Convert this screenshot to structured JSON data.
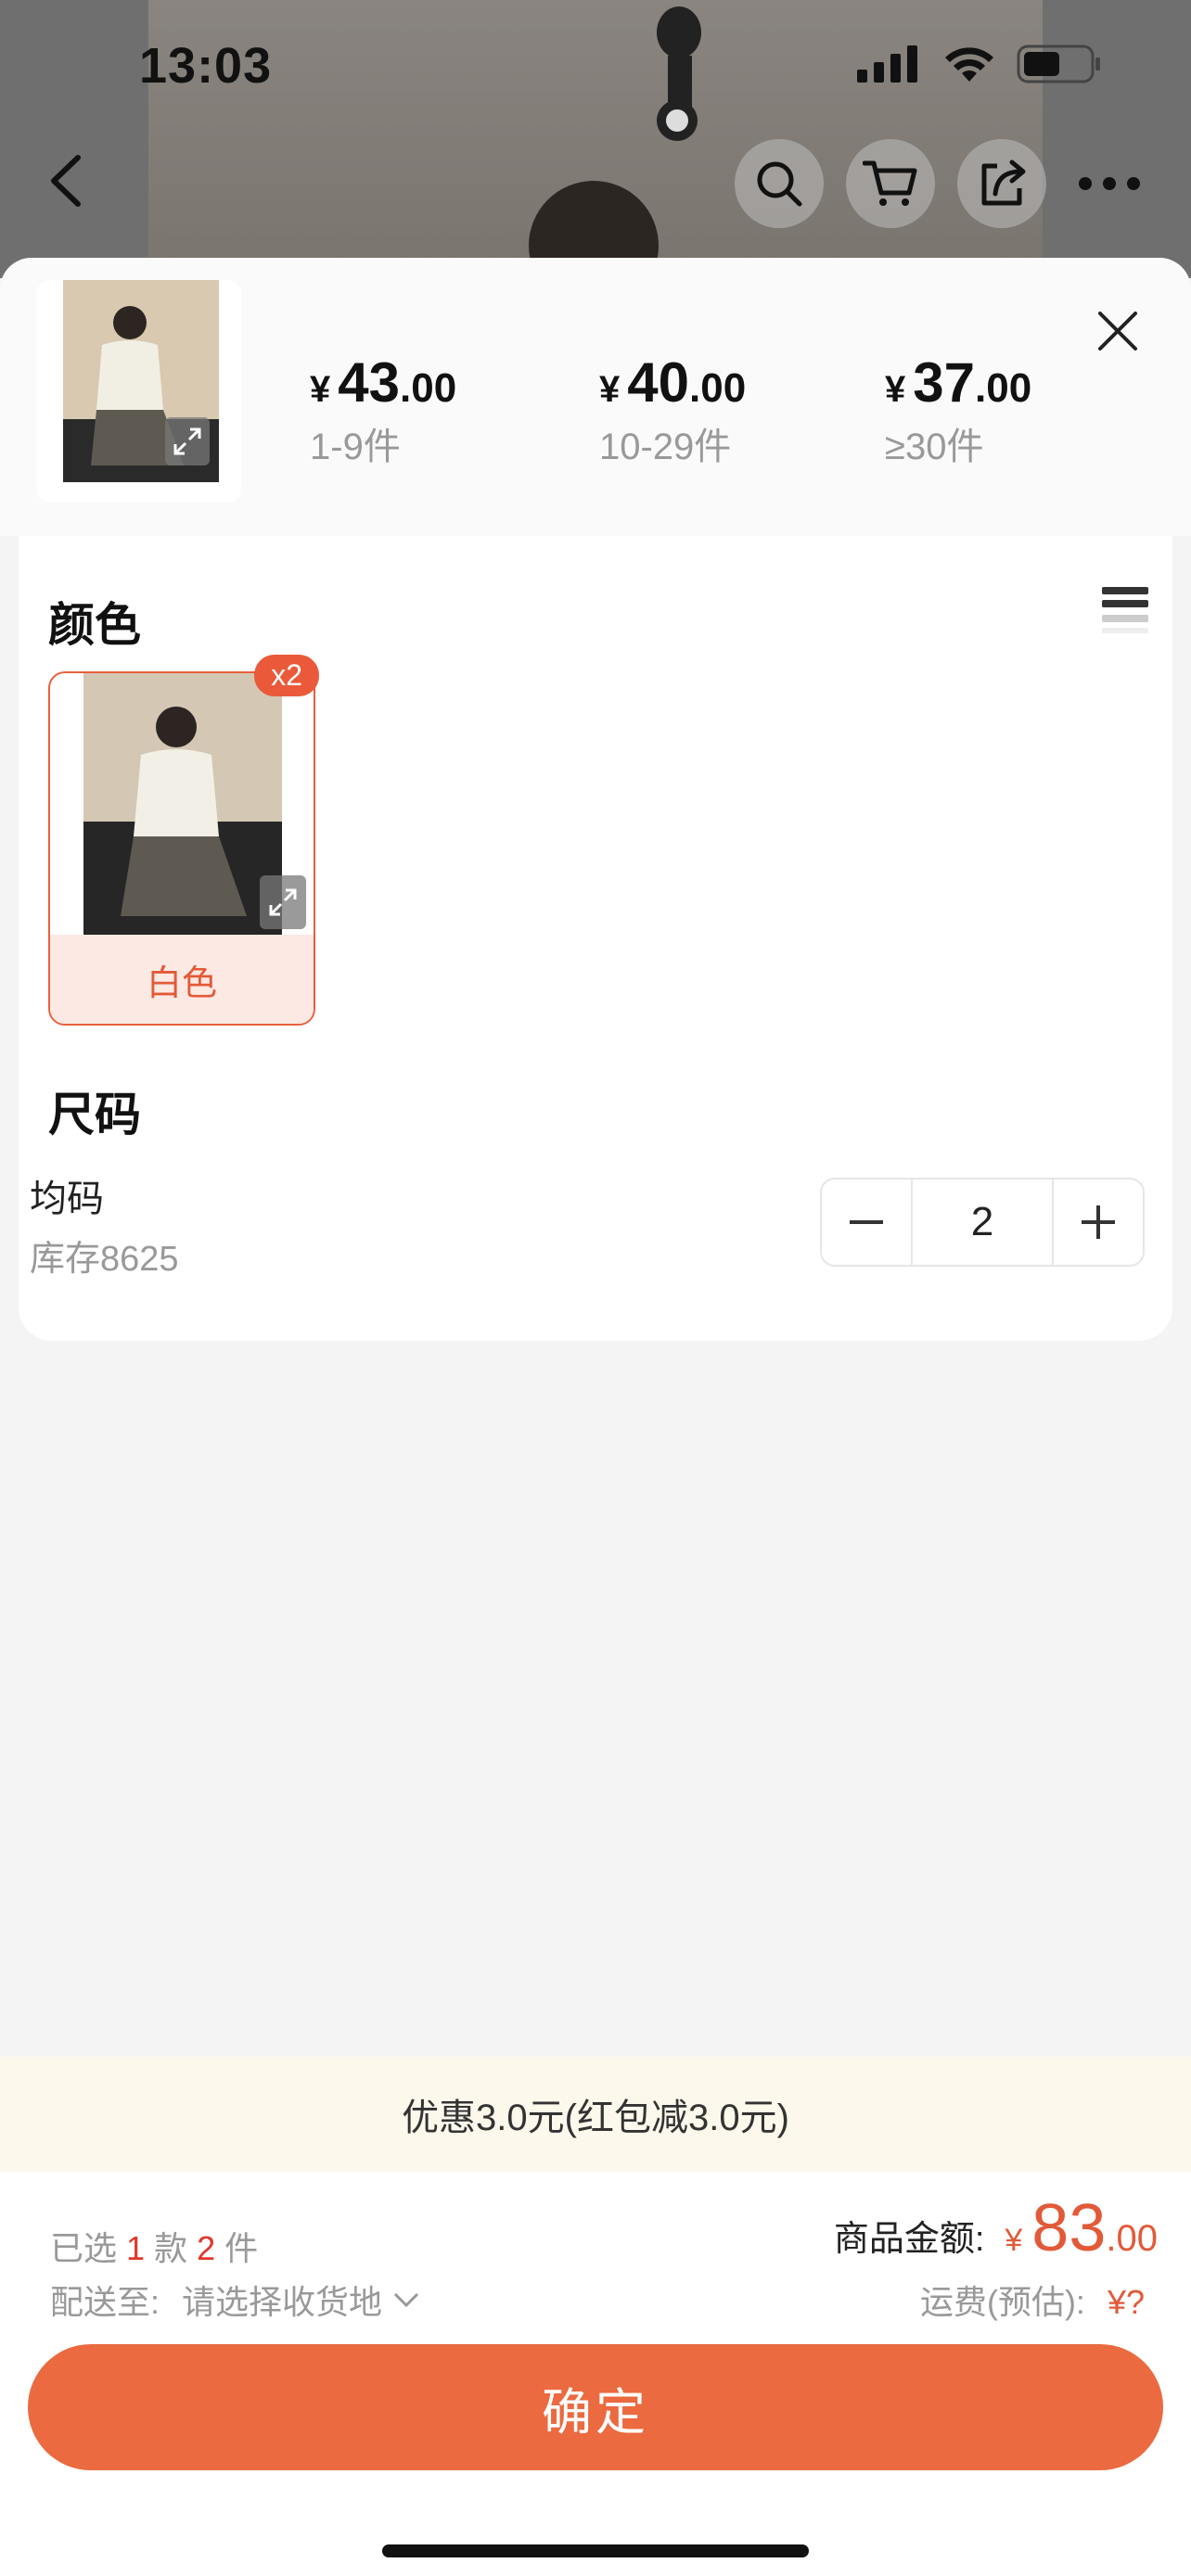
{
  "status": {
    "time": "13:03"
  },
  "nav": {
    "icons": [
      "back-icon",
      "search-icon",
      "cart-icon",
      "share-icon",
      "more-icon"
    ]
  },
  "prices": [
    {
      "yen": "¥",
      "int": "43",
      "dec": ".00",
      "tier": "1-9件"
    },
    {
      "yen": "¥",
      "int": "40",
      "dec": ".00",
      "tier": "10-29件"
    },
    {
      "yen": "¥",
      "int": "37",
      "dec": ".00",
      "tier": "≥30件"
    }
  ],
  "color": {
    "title": "颜色",
    "option_label": "白色",
    "badge": "x2"
  },
  "size": {
    "title": "尺码",
    "name": "均码",
    "stock": "库存8625",
    "quantity": "2"
  },
  "promo": {
    "text": "优惠3.0元(红包减3.0元)"
  },
  "summary": {
    "selected_prefix": "已选",
    "selected_kinds": "1",
    "kinds_unit": "款",
    "selected_count": "2",
    "count_unit": "件",
    "ship_label": "配送至:",
    "ship_value": "请选择收货地",
    "amount_label": "商品金额:",
    "amount_yen": "¥",
    "amount_int": "83",
    "amount_dec": ".00",
    "freight_label": "运费(预估):",
    "freight_value": "¥?"
  },
  "confirm_label": "确定",
  "colors": {
    "accent": "#eb6a3f",
    "price_red": "#e25a38",
    "badge": "#ea5a3a",
    "promo_bg": "#fdf8ec"
  }
}
